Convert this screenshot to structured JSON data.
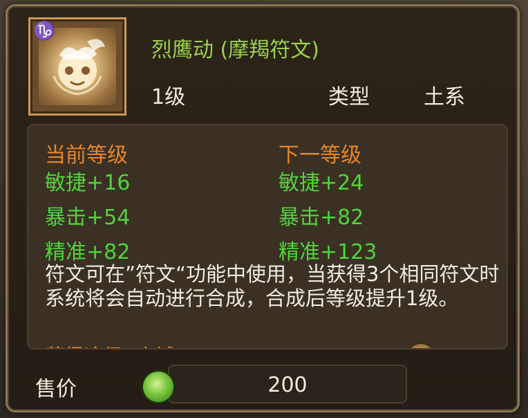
{
  "rune": {
    "sign_symbol": "♑",
    "icon": "eagle-rune-icon",
    "title": "烈鹰动 (摩羯符文)",
    "level": "1级",
    "type_label": "类型",
    "type_value": "土系"
  },
  "stats": {
    "current_header": "当前等级",
    "next_header": "下一等级",
    "current": [
      "敏捷+16",
      "暴击+54",
      "精准+82"
    ],
    "next": [
      "敏捷+24",
      "暴击+82",
      "精准+123"
    ]
  },
  "description": "符文可在”符文“功能中使用，当获得3个相同符文时系统将会自动进行合成，合成后等级提升1级。",
  "source_partial": "获得途径 [商城]",
  "price": {
    "label": "售价",
    "currency_icon": "green-coin-icon",
    "value": "200"
  },
  "colors": {
    "title_green": "#9bd24a",
    "stat_green": "#52d43a",
    "header_orange": "#e8852a",
    "text_white": "#f2ece0",
    "frame_gold": "#c99a55"
  }
}
